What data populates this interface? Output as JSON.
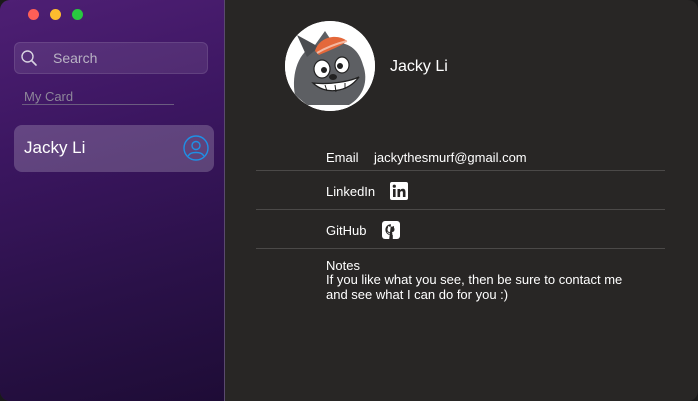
{
  "window": {
    "controls": [
      "close",
      "minimize",
      "zoom"
    ]
  },
  "sidebar": {
    "search": {
      "placeholder": "Search",
      "value": ""
    },
    "my_card_label": "My Card",
    "contacts": [
      {
        "name": "Jacky Li",
        "selected": true
      }
    ]
  },
  "detail": {
    "name": "Jacky Li",
    "fields": {
      "email_label": "Email",
      "email_value": "jackythesmurf@gmail.com",
      "linkedin_label": "LinkedIn",
      "github_label": "GitHub",
      "notes_label": "Notes",
      "notes_line1": "If you like what you see, then be sure to contact me",
      "notes_line2": "and see what I can do for you :)"
    },
    "icons": {
      "linkedin": "linkedin-icon",
      "github": "github-icon"
    }
  },
  "colors": {
    "sidebar_top": "#4e1f74",
    "sidebar_bottom": "#1e0c36",
    "main_bg": "#282625",
    "accent_blue": "#1e90e6"
  }
}
